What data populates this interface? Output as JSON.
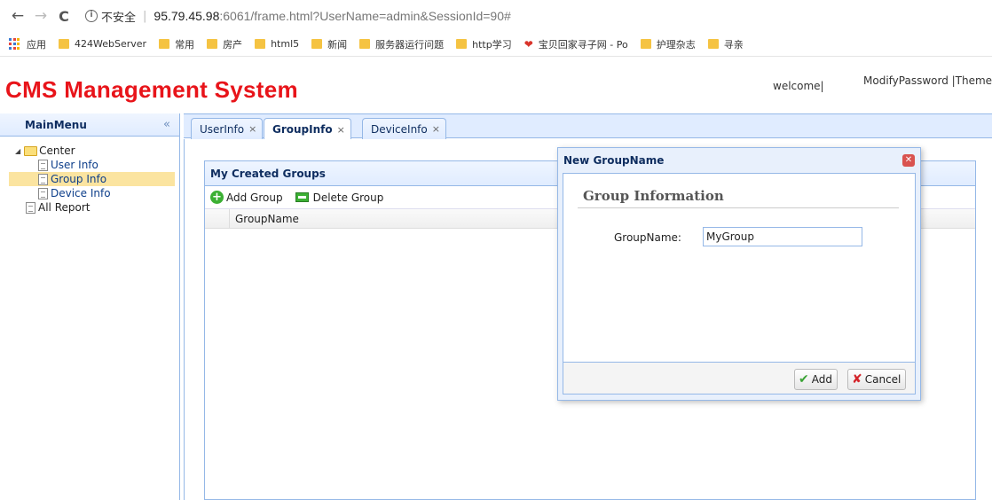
{
  "browser": {
    "back_glyph": "←",
    "forward_glyph": "→",
    "reload_glyph": "C",
    "security_label": "不安全",
    "url_host": "95.79.45.98",
    "url_rest": ":6061/frame.html?UserName=admin&SessionId=90#",
    "bookmarks": [
      {
        "label": "应用",
        "icon": "apps-icon"
      },
      {
        "label": "424WebServer",
        "icon": "folder-icon"
      },
      {
        "label": "常用",
        "icon": "folder-icon"
      },
      {
        "label": "房产",
        "icon": "folder-icon"
      },
      {
        "label": "html5",
        "icon": "folder-icon"
      },
      {
        "label": "新闻",
        "icon": "folder-icon"
      },
      {
        "label": "服务器运行问题",
        "icon": "folder-icon"
      },
      {
        "label": "http学习",
        "icon": "folder-icon"
      },
      {
        "label": "宝贝回家寻子网 - Po",
        "icon": "heart-icon"
      },
      {
        "label": "护理杂志",
        "icon": "folder-icon"
      },
      {
        "label": "寻亲",
        "icon": "folder-icon"
      }
    ]
  },
  "header": {
    "title": "CMS Management System",
    "welcome": "welcome|",
    "links": "ModifyPassword |Theme"
  },
  "mainmenu": {
    "title": "MainMenu",
    "collapse_glyph": "«",
    "tree": {
      "center": "Center",
      "user_info": "User Info",
      "group_info": "Group Info",
      "device_info": "Device Info",
      "all_report": "All Report"
    }
  },
  "tabs": [
    {
      "label": "UserInfo",
      "close": "×"
    },
    {
      "label": "GroupInfo",
      "close": "×"
    },
    {
      "label": "DeviceInfo",
      "close": "×"
    }
  ],
  "grid": {
    "title": "My Created Groups",
    "add_label": "Add Group",
    "delete_label": "Delete Group",
    "column": "GroupName"
  },
  "dialog": {
    "title": "New GroupName",
    "section_title": "Group Information",
    "field_label": "GroupName:",
    "field_value": "MyGroup",
    "add_label": "Add",
    "cancel_label": "Cancel"
  },
  "colors": {
    "title_red": "#e8141a",
    "panel_border": "#95b8e7",
    "header_blue": "#0e2d5f",
    "selected_row": "#fbe4a0"
  }
}
